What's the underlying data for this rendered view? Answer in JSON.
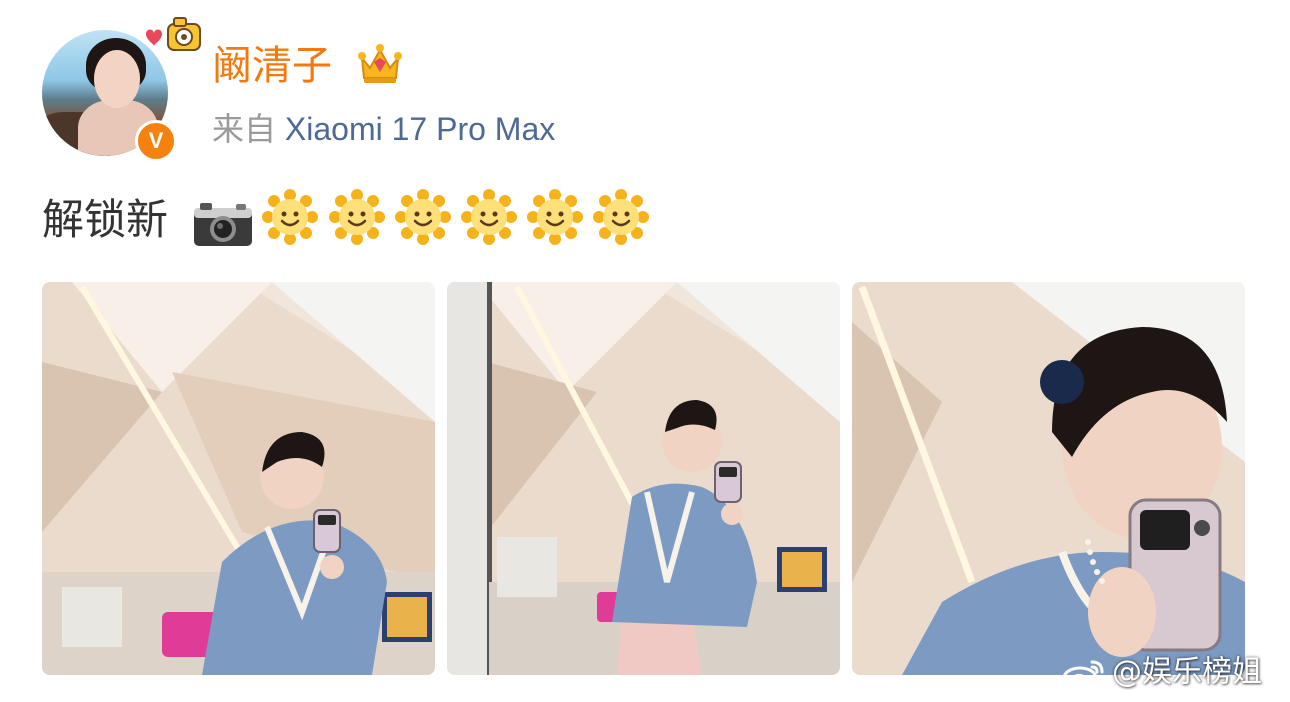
{
  "post": {
    "author": {
      "name": "阚清子",
      "verified_badge": "V",
      "avatar_icon": "user-avatar",
      "badge_icon": "crown-icon"
    },
    "source": {
      "prefix": "来自",
      "device": "Xiaomi 17 Pro Max"
    },
    "text": "解锁新",
    "emojis": [
      "camera-emoji",
      "sun-smile-emoji",
      "sun-smile-emoji",
      "sun-smile-emoji",
      "sun-smile-emoji",
      "sun-smile-emoji",
      "sun-smile-emoji"
    ],
    "images": [
      {
        "name": "photo-1"
      },
      {
        "name": "photo-2"
      },
      {
        "name": "photo-3"
      }
    ]
  },
  "watermark": {
    "text": "@娱乐榜姐",
    "icon": "weibo-logo-icon"
  },
  "colors": {
    "name": "#f5780c",
    "device": "#4d6a95",
    "muted": "#9a9a9a",
    "verified": "#f5820f"
  }
}
